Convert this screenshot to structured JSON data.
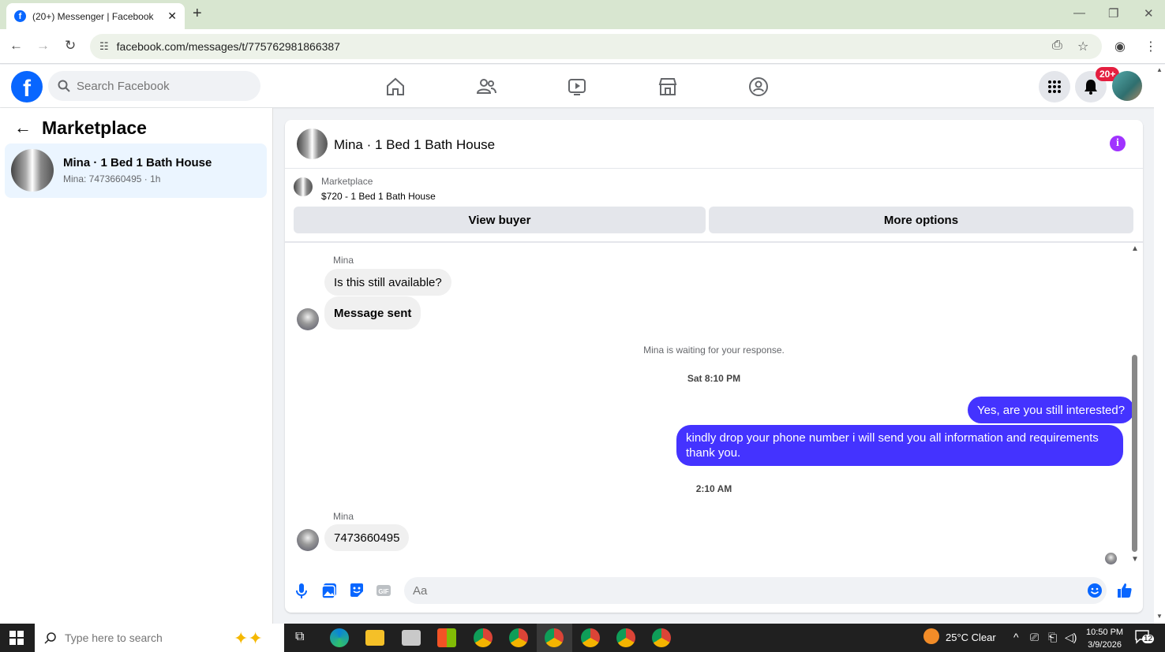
{
  "browser": {
    "tab_title": "(20+) Messenger | Facebook",
    "tab_close": "✕",
    "new_tab": "+",
    "url": "facebook.com/messages/t/775762981866387",
    "window_controls": [
      "—",
      "❐",
      "✕"
    ]
  },
  "fb": {
    "logo_letter": "f",
    "search_placeholder": "Search Facebook",
    "notification_badge": "20+"
  },
  "sidebar": {
    "title": "Marketplace",
    "conversation": {
      "name": "Mina · 1 Bed 1 Bath House",
      "subtitle": "Mina: 7473660495 · 1h"
    }
  },
  "chat": {
    "header_title": "Mina · 1 Bed 1 Bath House",
    "info_icon_glyph": "i",
    "marketplace_label": "Marketplace",
    "listing": "$720 - 1 Bed 1 Bath House",
    "view_buyer": "View buyer",
    "more_options": "More options",
    "messages": [
      {
        "sender": "Mina"
      },
      {
        "text": "Is this still available?"
      },
      {
        "text": "Message sent"
      },
      {
        "system": "Mina is waiting for your response."
      },
      {
        "timestamp": "Sat 8:10 PM"
      },
      {
        "text": "Yes, are you still interested?"
      },
      {
        "text": "kindly drop your phone number i will send you all information and requirements thank you."
      },
      {
        "timestamp": "2:10 AM"
      },
      {
        "sender": "Mina"
      },
      {
        "text": "7473660495"
      }
    ],
    "composer_placeholder": "Aa"
  },
  "taskbar": {
    "search_placeholder": "Type here to search",
    "weather": "25°C  Clear",
    "time": "10:50 PM",
    "date": "3/9/2026",
    "notification_count": "12"
  },
  "colors": {
    "fb_blue": "#0866ff",
    "outgoing_bubble": "#4433ff",
    "badge_red": "#e41e3f",
    "info_purple": "#a033ff"
  }
}
